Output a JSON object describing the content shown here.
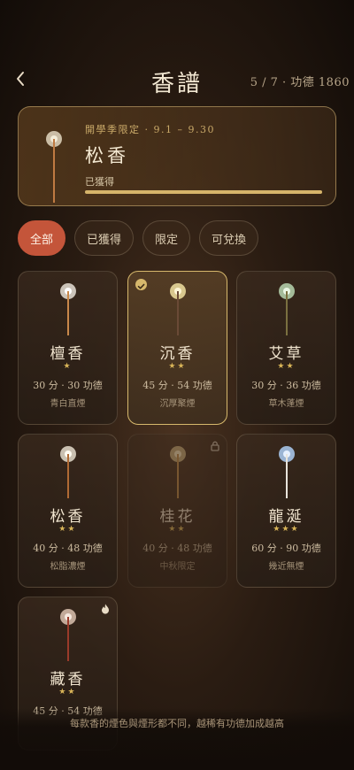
{
  "header": {
    "title": "香譜",
    "progress": "5 / 7 · 功德 1860",
    "back_icon": "chevron-left-icon"
  },
  "featured": {
    "label": "開學季限定 · 9.1 – 9.30",
    "name": "松香",
    "status": "已獲得",
    "progress": 1.0
  },
  "tabs": [
    {
      "label": "全部",
      "active": true
    },
    {
      "label": "已獲得",
      "active": false
    },
    {
      "label": "限定",
      "active": false
    },
    {
      "label": "可兌換",
      "active": false
    }
  ],
  "incense": [
    {
      "name": "檀香",
      "stars": "★",
      "stats": "30 分 · 30 功德",
      "desc": "青白直煙",
      "state": "owned"
    },
    {
      "name": "沉香",
      "stars": "★★",
      "stats": "45 分 · 54 功德",
      "desc": "沉厚聚煙",
      "state": "selected"
    },
    {
      "name": "艾草",
      "stars": "★★",
      "stats": "30 分 · 36 功德",
      "desc": "草木蓬煙",
      "state": "owned"
    },
    {
      "name": "松香",
      "stars": "★★",
      "stats": "40 分 · 48 功德",
      "desc": "松脂濃煙",
      "state": "owned"
    },
    {
      "name": "桂花",
      "stars": "★★",
      "stats": "40 分 · 48 功德",
      "desc": "中秋限定",
      "state": "locked"
    },
    {
      "name": "龍涎",
      "stars": "★★★",
      "stats": "60 分 · 90 功德",
      "desc": "幾近無煙",
      "state": "owned"
    },
    {
      "name": "藏香",
      "stars": "★★",
      "stats": "45 分 · 54 功德",
      "desc": "",
      "state": "owned"
    }
  ],
  "footer": {
    "note": "每款香的煙色與煙形都不同，越稀有功德加成越高"
  },
  "colors": {
    "accent": "#c4553a",
    "gold": "#d6b86c"
  }
}
